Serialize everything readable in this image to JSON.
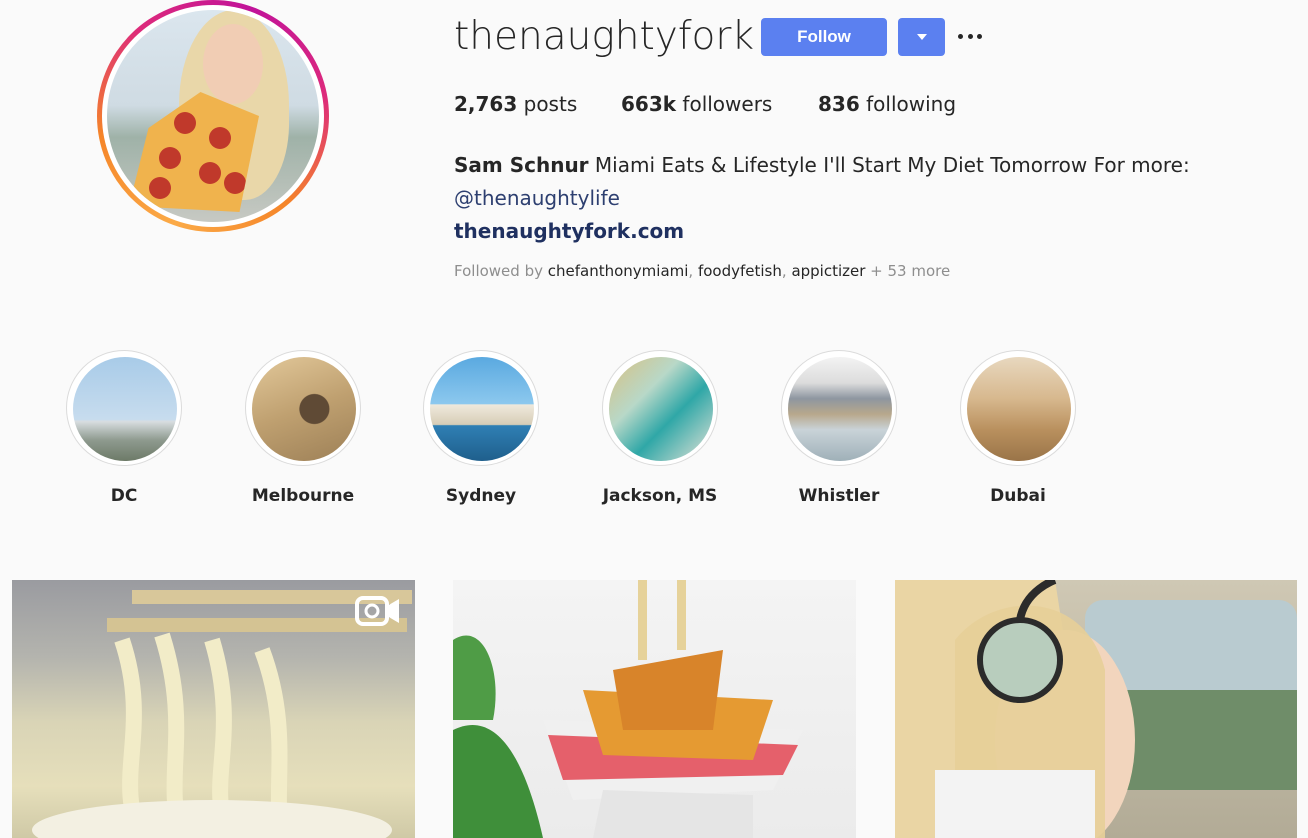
{
  "profile": {
    "username": "thenaughtyfork",
    "follow_label": "Follow",
    "stats": {
      "posts_count": "2,763",
      "posts_label": " posts",
      "followers_count": "663k",
      "followers_label": " followers",
      "following_count": "836",
      "following_label": " following"
    },
    "bio": {
      "name": "Sam Schnur",
      "text": " Miami Eats & Lifestyle I'll Start My Diet Tomorrow For more:",
      "mention": "@thenaughtylife",
      "website": "thenaughtyfork.com"
    },
    "followed_by": {
      "prefix": "Followed by ",
      "users": [
        "chefanthonymiami",
        "foodyfetish",
        "appictizer"
      ],
      "more": " + 53 more"
    }
  },
  "highlights": [
    {
      "label": "DC"
    },
    {
      "label": "Melbourne"
    },
    {
      "label": "Sydney"
    },
    {
      "label": "Jackson, MS"
    },
    {
      "label": "Whistler"
    },
    {
      "label": "Dubai"
    }
  ],
  "posts": [
    {
      "kind": "video"
    },
    {
      "kind": "photo"
    },
    {
      "kind": "photo"
    }
  ],
  "colors": {
    "button": "#5b80f0",
    "link": "#1f3060",
    "ring_gradient": [
      "#fbaa47",
      "#dd2a7b",
      "#c1139a"
    ]
  }
}
